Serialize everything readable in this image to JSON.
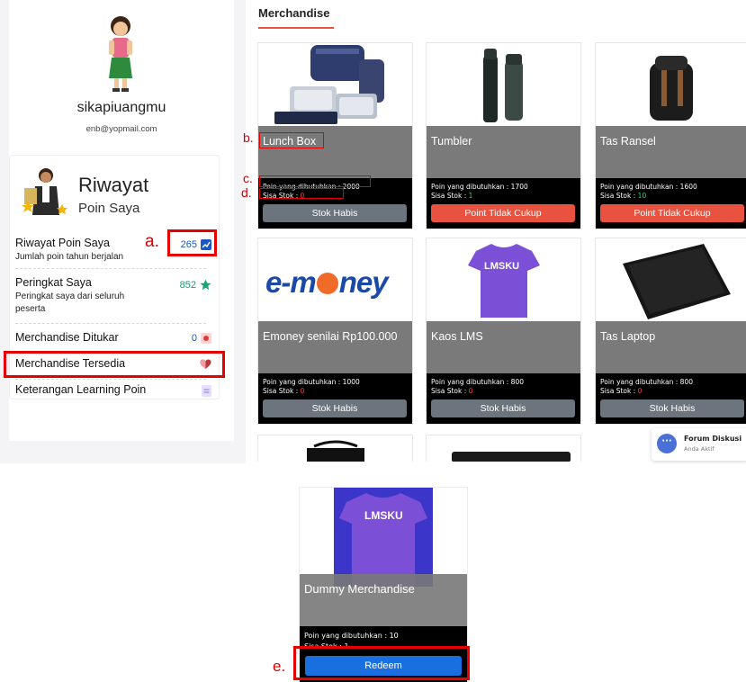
{
  "profile": {
    "username": "sikapiuangmu",
    "email": "enb@yopmail.com"
  },
  "riwayat": {
    "title": "Riwayat",
    "subtitle": "Poin Saya"
  },
  "menu": [
    {
      "title": "Riwayat Poin Saya",
      "desc": "Jumlah poin tahun berjalan",
      "value": "265",
      "icon": "chart-icon"
    },
    {
      "title": "Peringkat Saya",
      "desc": "Peringkat saya dari seluruh peserta",
      "value": "852",
      "icon": "star-icon"
    },
    {
      "title": "Merchandise Ditukar",
      "value": "0",
      "icon": "box-icon"
    },
    {
      "title": "Merchandise Tersedia",
      "icon": "heart-icon"
    },
    {
      "title": "Keterangan Learning Poin",
      "icon": "document-icon"
    }
  ],
  "annotations": {
    "a": "a.",
    "b": "b.",
    "c": "c.",
    "d": "d.",
    "e": "e."
  },
  "section": {
    "title": "Merchandise"
  },
  "labels": {
    "need": "Poin yang dibutuhkan : ",
    "stock": "Sisa Stok : "
  },
  "products": [
    {
      "name": "Lunch Box",
      "points": "2000",
      "stock": "0",
      "stock_color": "#ff3b3b",
      "button": "Stok Habis"
    },
    {
      "name": "Tumbler",
      "points": "1700",
      "stock": "1",
      "stock_color": "#3ccf6b",
      "button": "Point Tidak Cukup"
    },
    {
      "name": "Tas Ransel",
      "points": "1600",
      "stock": "10",
      "stock_color": "#3ccf6b",
      "button": "Point Tidak Cukup"
    },
    {
      "name": "Emoney senilai Rp100.000",
      "points": "1000",
      "stock": "0",
      "stock_color": "#ff3b3b",
      "button": "Stok Habis"
    },
    {
      "name": "Kaos LMS",
      "points": "800",
      "stock": "0",
      "stock_color": "#ff3b3b",
      "button": "Stok Habis"
    },
    {
      "name": "Tas Laptop",
      "points": "800",
      "stock": "0",
      "stock_color": "#ff3b3b",
      "button": "Stok Habis"
    }
  ],
  "logos": {
    "emoney": "e-m",
    "emoney2": "ney",
    "lmsku": "LMSKU"
  },
  "forum": {
    "title": "Forum Diskusi",
    "subtitle": "Anda Aktif"
  },
  "dummy": {
    "name": "Dummy Merchandise",
    "points": "10",
    "stock": "1",
    "button": "Redeem"
  }
}
